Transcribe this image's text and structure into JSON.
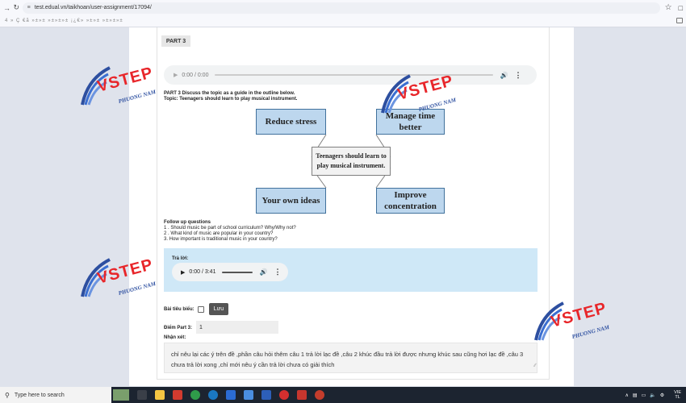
{
  "browser": {
    "url": "test.edual.vn/taikhoan/user-assignment/17094/",
    "bookmarks_text": "4   »   Ç  €ã »±»± »±»±»± ¡¿€»   »±»± »±»±»±"
  },
  "part": {
    "label": "PART 3",
    "audio_time": "0:00 / 0:00",
    "instruction": "PART 3 Discuss the topic as a guide in the outline below.",
    "topic": "Topic: Teenagers should learn to play musical instrument."
  },
  "diagram": {
    "center": "Teenagers should learn to play musical instrument.",
    "top_left": "Reduce stress",
    "top_right": "Manage time better",
    "bottom_left": "Your own ideas",
    "bottom_right": "Improve concentration"
  },
  "followup": {
    "heading": "Follow up questions",
    "q1": "1 . Should music be part of school curriculum? Why/Why not?",
    "q2": "2 . What kind of music are popular in your country?",
    "q3": "3.  How important is traditional music in your country?"
  },
  "answer": {
    "label": "Trả lời:",
    "audio_time": "0:00 / 3:41"
  },
  "form": {
    "sample_label": "Bài tiêu biểu:",
    "save_label": "Lưu",
    "score_label": "Điểm Part 3:",
    "score_value": "1",
    "comment_label": "Nhận xét:",
    "comment_text": "chỉ nêu lại các ý trên đề ,phần câu hỏi thêm câu 1 trả lời lạc đề ,câu 2 khúc đầu trả lời được nhưng khúc sau cũng hơi lạc đề ,câu 3 chưa trả lời xong ,chỉ mới nêu ý cần trả lời chưa có giải thích"
  },
  "watermark": {
    "word": "VSTEP",
    "sub": "PHUONG NAM"
  },
  "taskbar": {
    "search_placeholder": "Type here to search",
    "lang_line1": "VIE",
    "lang_line2": "TL"
  },
  "colors": {
    "diagram_fill": "#bdd7ee",
    "diagram_border": "#41719c",
    "answer_bg": "#cfe8f7",
    "watermark_red": "#e8262a",
    "watermark_blue": "#2d4fa0"
  }
}
